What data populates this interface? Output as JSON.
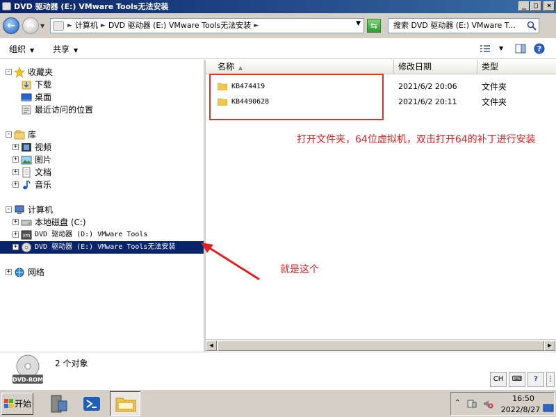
{
  "window": {
    "title": "DVD 驱动器 (E:) VMware Tools无法安装",
    "buttons": {
      "minimize": "_",
      "maximize": "□",
      "close": "×"
    }
  },
  "address": {
    "crumbs": [
      "计算机",
      "DVD 驱动器 (E:) VMware Tools无法安装"
    ],
    "search_placeholder": "搜索 DVD 驱动器 (E:) VMware T..."
  },
  "toolbar": {
    "organize_label": "组织",
    "share_label": "共享"
  },
  "nav": {
    "favorites": {
      "label": "收藏夹",
      "items": [
        "下载",
        "桌面",
        "最近访问的位置"
      ]
    },
    "libraries": {
      "label": "库",
      "items": [
        "视频",
        "图片",
        "文档",
        "音乐"
      ]
    },
    "computer": {
      "label": "计算机",
      "items": [
        "本地磁盘 (C:)",
        "DVD 驱动器 (D:) VMware Tools",
        "DVD 驱动器 (E:) VMware Tools无法安装"
      ]
    },
    "network": {
      "label": "网络"
    }
  },
  "content": {
    "columns": {
      "name": "名称",
      "modified": "修改日期",
      "type": "类型"
    },
    "files": [
      {
        "name": "KB474419",
        "modified": "2021/6/2 20:06",
        "type": "文件夹"
      },
      {
        "name": "KB4490628",
        "modified": "2021/6/2 20:11",
        "type": "文件夹"
      }
    ]
  },
  "annotations": {
    "instruction": "打开文件夹，64位虚拟机，双击打开64的补丁进行安装",
    "pointer": "就是这个",
    "color": "#e02020"
  },
  "details": {
    "count": "2 个对象",
    "drive_label": "DVD-ROM"
  },
  "taskbar": {
    "start_label": "开始",
    "tray_lang": "CH",
    "time": "16:50",
    "date": "2022/8/27"
  },
  "colors": {
    "titlebar": "#0a246a",
    "selection": "#0a246a"
  }
}
